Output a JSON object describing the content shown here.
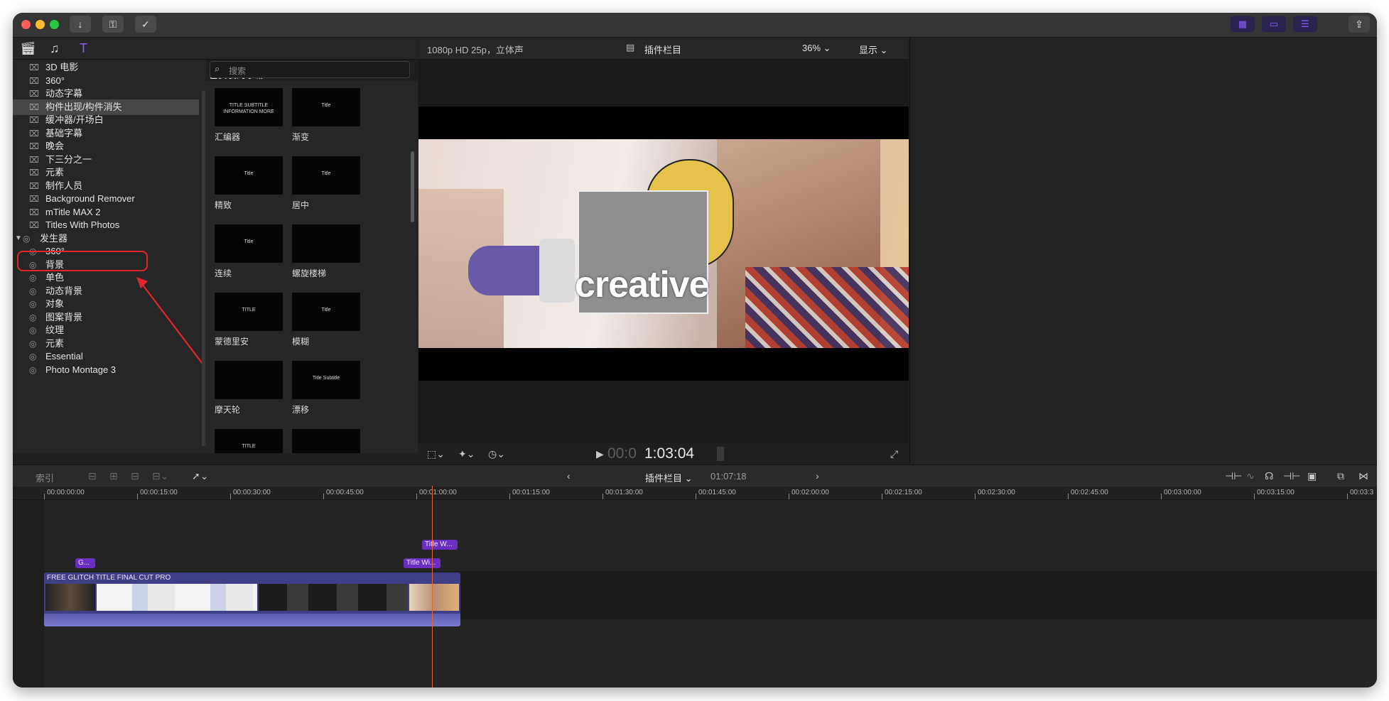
{
  "window": {
    "title_buttons": [
      "↓",
      "⚿",
      "✓"
    ],
    "workspace_icons": [
      "browser-toggle-icon",
      "timeline-toggle-icon",
      "inspector-toggle-icon"
    ],
    "share_icon": "share-icon"
  },
  "browser": {
    "source_icons": [
      "clapper-icon",
      "music-icon",
      "titles-generators-icon"
    ],
    "categories": [
      {
        "label": "3D 电影"
      },
      {
        "label": "360°"
      },
      {
        "label": "动态字幕"
      },
      {
        "label": "构件出现/构件消失",
        "selected": true
      },
      {
        "label": "缓冲器/开场白"
      },
      {
        "label": "基础字幕"
      },
      {
        "label": "晚会"
      },
      {
        "label": "下三分之一"
      },
      {
        "label": "元素"
      },
      {
        "label": "制作人员"
      },
      {
        "label": "Background Remover"
      },
      {
        "label": "mTitle MAX 2"
      },
      {
        "label": "Titles With Photos",
        "highlighted": true
      }
    ],
    "generators_label": "发生器",
    "generators": [
      {
        "label": "360°"
      },
      {
        "label": "背景"
      },
      {
        "label": "单色"
      },
      {
        "label": "动态背景"
      },
      {
        "label": "对象"
      },
      {
        "label": "图案背景"
      },
      {
        "label": "纹理"
      },
      {
        "label": "元素"
      },
      {
        "label": "Essential"
      },
      {
        "label": "Photo Montage 3"
      }
    ]
  },
  "titles": {
    "header": "已安装的字幕",
    "search_placeholder": "搜索",
    "items": [
      {
        "name": "汇编器",
        "thumb": "TITLE SUBTITLE INFORMATION MORE"
      },
      {
        "name": "渐变",
        "thumb": "Title"
      },
      {
        "name": "精致",
        "thumb": "Title"
      },
      {
        "name": "居中",
        "thumb": "Title"
      },
      {
        "name": "连续",
        "thumb": "Title"
      },
      {
        "name": "螺旋楼梯",
        "thumb": ""
      },
      {
        "name": "蒙德里安",
        "thumb": "TITLE"
      },
      {
        "name": "模糊",
        "thumb": "Title"
      },
      {
        "name": "摩天轮",
        "thumb": ""
      },
      {
        "name": "漂移",
        "thumb": "Title Subtitle"
      },
      {
        "name": "",
        "thumb": "TITLE"
      },
      {
        "name": "",
        "thumb": ""
      }
    ]
  },
  "viewer": {
    "format": "1080p HD 25p，立体声",
    "clip_title": "插件栏目",
    "zoom": "36%",
    "display": "显示",
    "overlay_text": "creative",
    "timecode_dim": "00:0",
    "timecode": "1:03:04"
  },
  "timeline": {
    "index_label": "索引",
    "project_name": "插件栏目",
    "duration": "01:07:18",
    "ruler": [
      "00:00:00:00",
      "00:00:15:00",
      "00:00:30:00",
      "00:00:45:00",
      "00:01:00:00",
      "00:01:15:00",
      "00:01:30:00",
      "00:01:45:00",
      "00:02:00:00",
      "00:02:15:00",
      "00:02:30:00",
      "00:02:45:00",
      "00:03:00:00",
      "00:03:15:00",
      "00:03:3"
    ],
    "title_clip_top": "Title W...",
    "title_clip_mid": "Title Wi...",
    "title_clip_left": "G...",
    "main_clip": "FREE GLITCH TITLE  FINAL CUT PRO",
    "colors": {
      "title_clip": "#6a2fc2",
      "main_clip": "#3f3f86",
      "playhead": "#e8642a",
      "highlight": "#e3262c"
    }
  }
}
